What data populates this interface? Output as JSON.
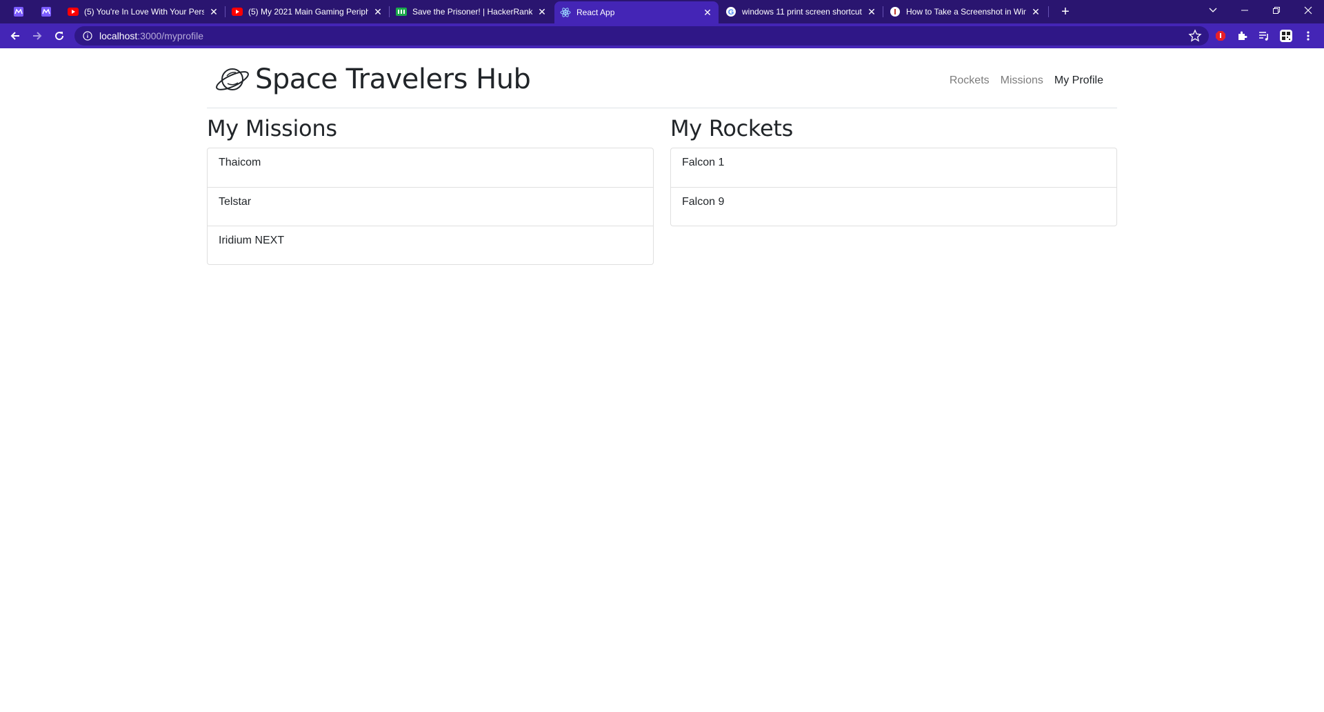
{
  "browser": {
    "tabs": [
      {
        "title": "",
        "favicon": "purple-m-icon",
        "pinned": true
      },
      {
        "title": "",
        "favicon": "purple-m-icon",
        "pinned": true
      },
      {
        "title": "(5) You're In Love With Your Pers",
        "favicon": "youtube-icon"
      },
      {
        "title": "(5) My 2021 Main Gaming Periph",
        "favicon": "youtube-icon"
      },
      {
        "title": "Save the Prisoner! | HackerRank",
        "favicon": "hackerrank-icon"
      },
      {
        "title": "React App",
        "favicon": "react-icon",
        "active": true
      },
      {
        "title": "windows 11 print screen shortcut",
        "favicon": "google-icon"
      },
      {
        "title": "How to Take a Screenshot in Win",
        "favicon": "info-icon"
      }
    ],
    "address": {
      "host": "localhost",
      "path": ":3000/myprofile"
    }
  },
  "header": {
    "brand": "Space Travelers Hub",
    "nav": [
      {
        "label": "Rockets",
        "active": false
      },
      {
        "label": "Missions",
        "active": false
      },
      {
        "label": "My Profile",
        "active": true
      }
    ]
  },
  "missions": {
    "heading": "My Missions",
    "items": [
      "Thaicom",
      "Telstar",
      "Iridium NEXT"
    ]
  },
  "rockets": {
    "heading": "My Rockets",
    "items": [
      "Falcon 1",
      "Falcon 9"
    ]
  },
  "colors": {
    "tabstrip": "#2a1570",
    "toolbar": "#4425b6",
    "omnibox": "#2f1787"
  }
}
